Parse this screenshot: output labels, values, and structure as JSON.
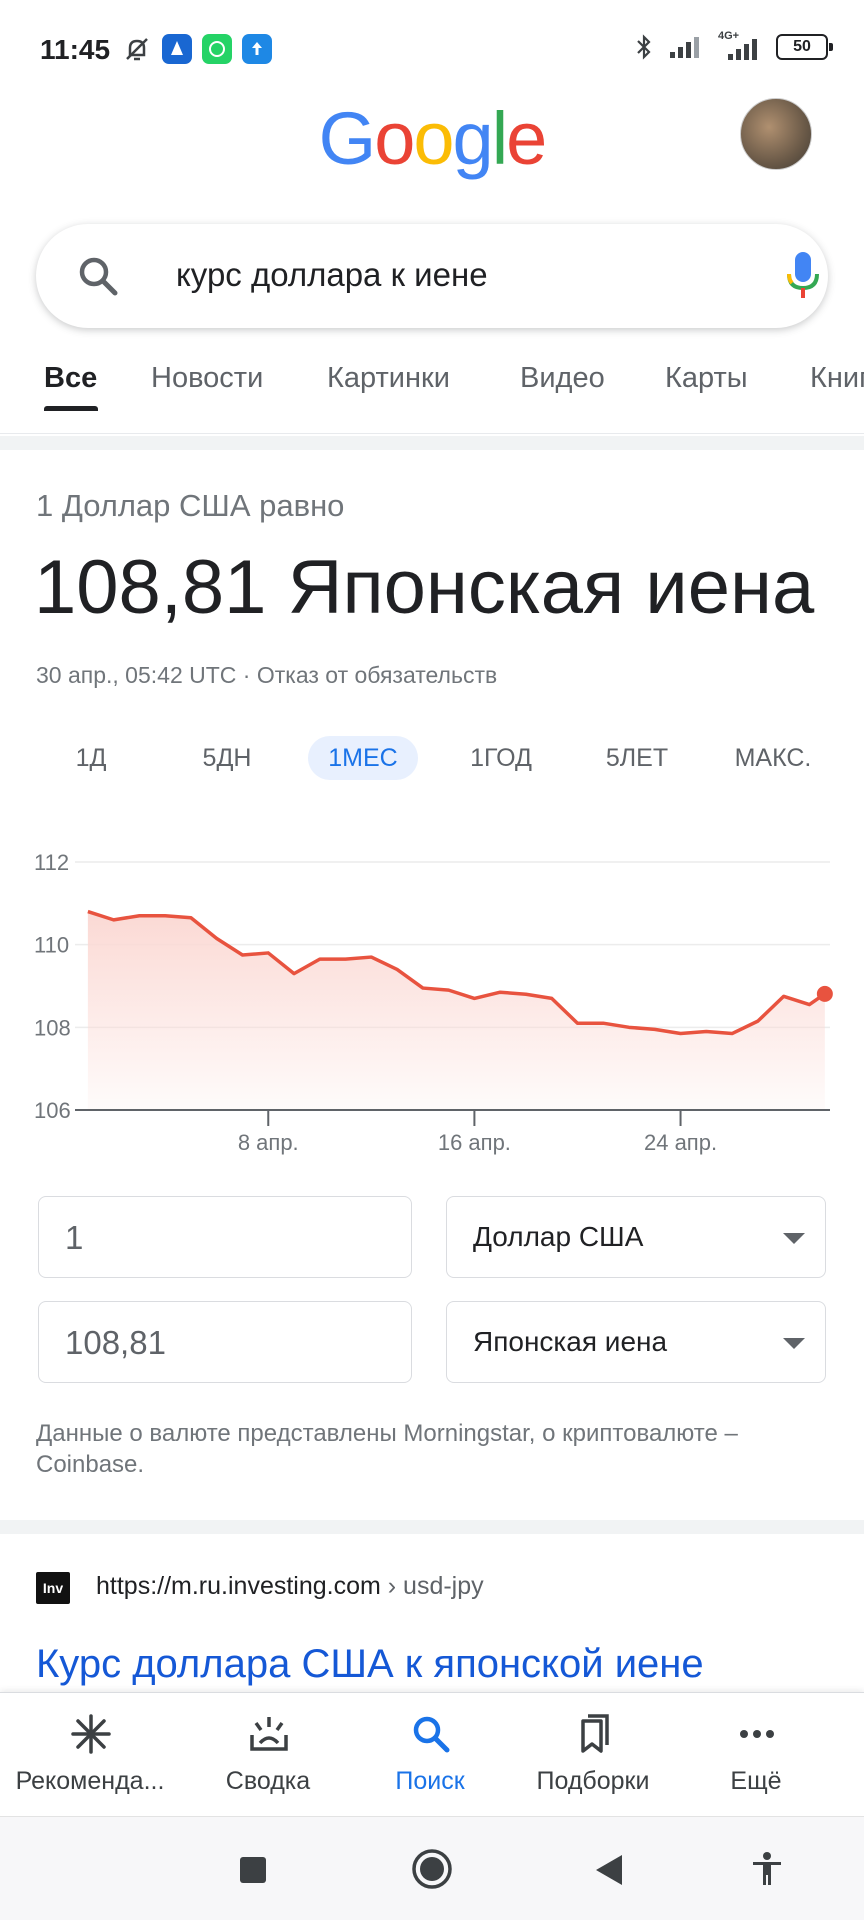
{
  "status_bar": {
    "time": "11:45",
    "battery": "50",
    "network": "4G+"
  },
  "search": {
    "query": "курс доллара к иене"
  },
  "tabs": [
    {
      "label": "Все"
    },
    {
      "label": "Новости"
    },
    {
      "label": "Картинки"
    },
    {
      "label": "Видео"
    },
    {
      "label": "Карты"
    },
    {
      "label": "Книги"
    }
  ],
  "currency": {
    "label": "1 Доллар США равно",
    "value": "108,81 Японская иена",
    "date": "30 апр., 05:42 UTC · Отказ от обязательств",
    "ranges": [
      "1Д",
      "5ДН",
      "1МЕС",
      "1ГОД",
      "5ЛЕТ",
      "МАКС."
    ],
    "active_range": "1МЕС"
  },
  "chart_data": {
    "type": "area",
    "y_ticks": [
      "112",
      "110",
      "108",
      "106"
    ],
    "ylim": [
      106,
      112
    ],
    "x_ticks": [
      "8 апр.",
      "16 апр.",
      "24 апр."
    ],
    "x_tick_positions": [
      8,
      16,
      24
    ],
    "xlim": [
      0.5,
      29.8
    ],
    "x": [
      1,
      2,
      3,
      4,
      5,
      6,
      7,
      8,
      9,
      10,
      11,
      12,
      13,
      14,
      15,
      16,
      17,
      18,
      19,
      20,
      21,
      22,
      23,
      24,
      25,
      26,
      27,
      28,
      29,
      29.6
    ],
    "series": [
      {
        "values": [
          110.8,
          110.6,
          110.7,
          110.7,
          110.65,
          110.15,
          109.75,
          109.8,
          109.3,
          109.65,
          109.65,
          109.7,
          109.4,
          108.95,
          108.9,
          108.7,
          108.85,
          108.8,
          108.7,
          108.1,
          108.1,
          108.0,
          107.95,
          107.85,
          107.9,
          107.85,
          108.15,
          108.75,
          108.55,
          108.81
        ]
      }
    ],
    "line_color": "#e8533f",
    "fill_color": "#fbd9d4",
    "grid": true
  },
  "converter": {
    "amount_from": "1",
    "currency_from": "Доллар США",
    "amount_to": "108,81",
    "currency_to": "Японская иена"
  },
  "source_note": "Данные о валюте представлены Morningstar, о криптовалюте – Coinbase.",
  "result": {
    "favicon": "Inv",
    "url_host": "https://m.ru.investing.com",
    "url_path": " › usd-jpy",
    "title": "Курс доллара США к японской иене"
  },
  "bottom_nav": [
    {
      "label": "Рекоменда...",
      "icon": "asterisk-icon"
    },
    {
      "label": "Сводка",
      "icon": "summary-icon"
    },
    {
      "label": "Поиск",
      "icon": "search-icon"
    },
    {
      "label": "Подборки",
      "icon": "bookmarks-icon"
    },
    {
      "label": "Ещё",
      "icon": "more-icon"
    }
  ],
  "colors": {
    "blue": "#4285F4",
    "red": "#EA4335",
    "yellow": "#FBBC05",
    "green": "#34A853",
    "accent": "#1a73e8"
  }
}
